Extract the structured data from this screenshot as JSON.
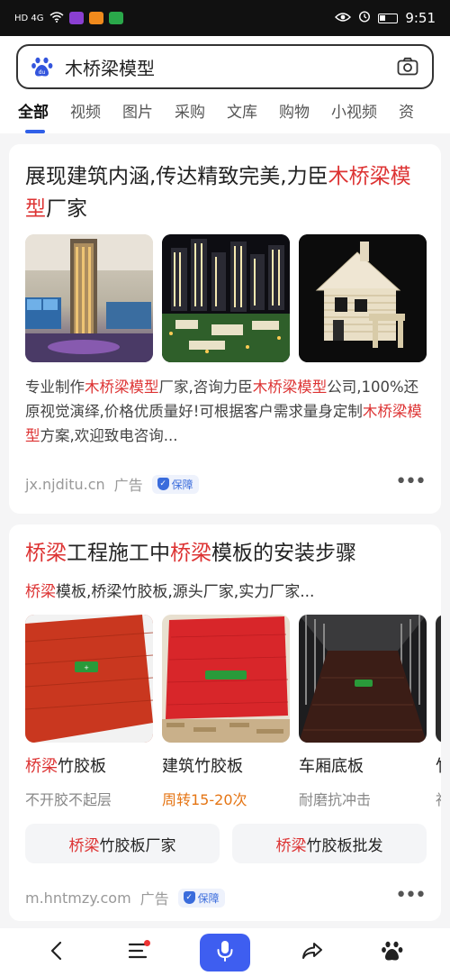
{
  "status_bar": {
    "left": "HD 4G",
    "time": "9:51"
  },
  "search": {
    "query": "木桥梁模型"
  },
  "tabs": [
    "全部",
    "视频",
    "图片",
    "采购",
    "文库",
    "购物",
    "小视频",
    "资"
  ],
  "result1": {
    "title_a": "展现建筑内涵,传达精致完美,力臣",
    "title_b": "木桥",
    "title_c": "梁模型",
    "title_d": "厂家",
    "desc_1": "专业制作",
    "desc_2": "木桥梁模型",
    "desc_3": "厂家,咨询力臣",
    "desc_4": "木桥梁模型",
    "desc_5": "公司,100%还原视觉演绎,价格优质量好!可根据客户需求量身定制",
    "desc_6": "木桥梁模型",
    "desc_7": "方案,欢迎致电咨询...",
    "source": "jx.njditu.cn",
    "ad": "广告",
    "badge": "保障",
    "more": "•••"
  },
  "result2": {
    "title_1": "桥梁",
    "title_2": "工程施工中",
    "title_3": "桥梁",
    "title_4": "模板的安装步骤",
    "sub_1": "桥梁",
    "sub_2": "模板,桥梁竹胶板,源头厂家,实力厂家...",
    "products": [
      {
        "name_red": "桥梁",
        "name": "竹胶板",
        "tag": "不开胶不起层"
      },
      {
        "name_red": "",
        "name": "建筑竹胶板",
        "tag": "周转15-20次"
      },
      {
        "name_red": "",
        "name": "车厢底板",
        "tag": "耐磨抗冲击"
      },
      {
        "name_red": "",
        "name": "竹",
        "tag": "社"
      }
    ],
    "pill_1_red": "桥梁",
    "pill_1": "竹胶板厂家",
    "pill_2_red": "桥梁",
    "pill_2": "竹胶板批发",
    "source": "m.hntmzy.com",
    "ad": "广告",
    "badge": "保障",
    "more": "•••"
  },
  "colors": {
    "accent": "#3e5ef0",
    "highlight": "#d33333",
    "orange_tag": "#e57514"
  },
  "icons": [
    "baidu-paw-icon",
    "camera-icon",
    "back-icon",
    "menu-icon",
    "mic-icon",
    "share-icon",
    "baidu-paw-icon"
  ]
}
